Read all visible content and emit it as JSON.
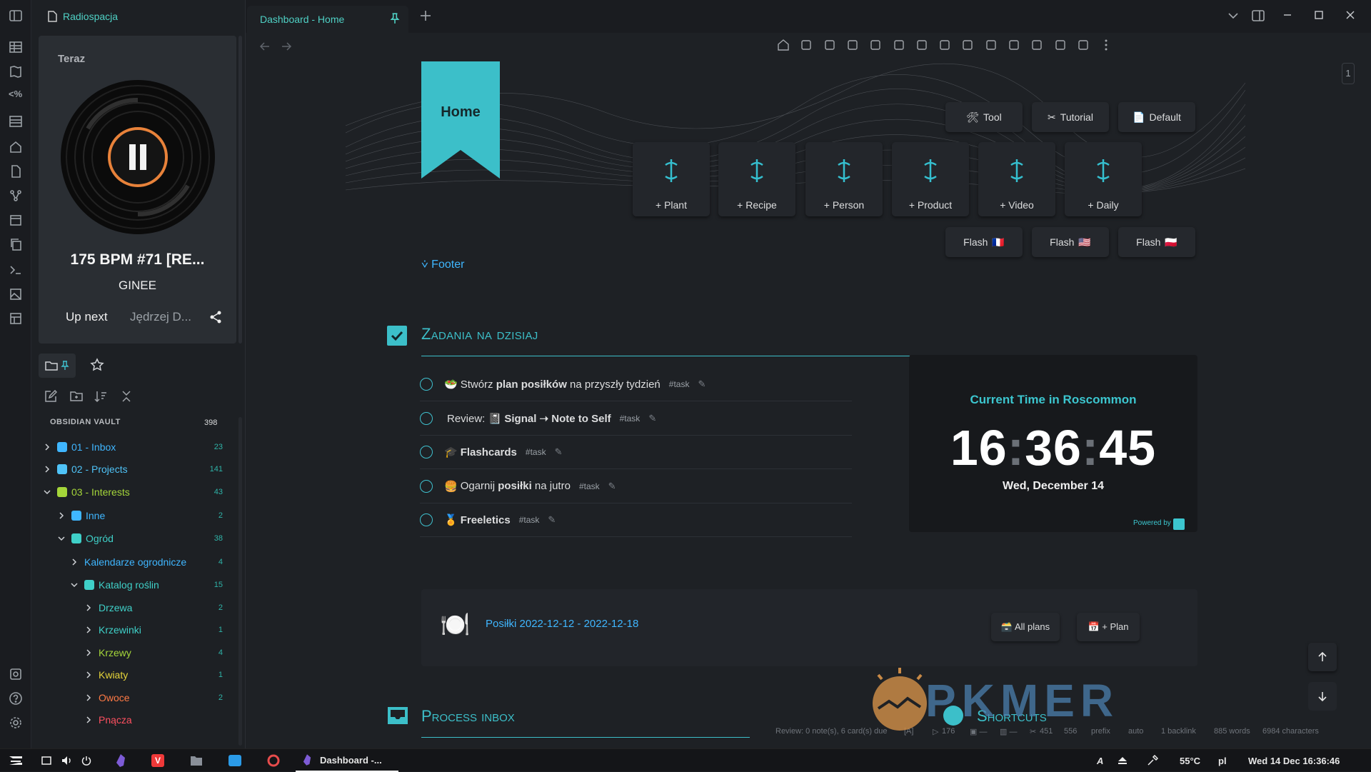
{
  "app": {
    "vault_name": "Radiospacja"
  },
  "tab": {
    "title": "Dashboard - Home"
  },
  "player": {
    "header": "Teraz",
    "track_title": "175 BPM #71 [RE...",
    "artist": "GINEE",
    "up_next_label": "Up next",
    "up_next_value": "Jędrzej D...",
    "accent": "#e8823a"
  },
  "vault": {
    "header": "OBSIDIAN VAULT",
    "count": "398",
    "items": [
      {
        "label": "01 - Inbox",
        "count": "23",
        "color": "#3fb6ff",
        "chevron": ">"
      },
      {
        "label": "02 - Projects",
        "count": "141",
        "color": "#4fc3f7",
        "chevron": ">"
      },
      {
        "label": "03 - Interests",
        "count": "43",
        "color": "#a5d63a",
        "chevron": "v"
      },
      {
        "label": "Inne",
        "count": "2",
        "color": "#3fb6ff",
        "chevron": ">"
      },
      {
        "label": "Ogród",
        "count": "38",
        "color": "#3fd0c8",
        "chevron": "v"
      },
      {
        "label": "Kalendarze ogrodnicze",
        "count": "4",
        "color": "#3fb6ff",
        "chevron": ">"
      },
      {
        "label": "Katalog roślin",
        "count": "15",
        "color": "#3fd0c8",
        "chevron": "v"
      },
      {
        "label": "Drzewa",
        "count": "2",
        "color": "#3fd0c8",
        "chevron": ">"
      },
      {
        "label": "Krzewinki",
        "count": "1",
        "color": "#3fd0c8",
        "chevron": ">"
      },
      {
        "label": "Krzewy",
        "count": "4",
        "color": "#a5d63a",
        "chevron": ">"
      },
      {
        "label": "Kwiaty",
        "count": "1",
        "color": "#e5d43a",
        "chevron": ">"
      },
      {
        "label": "Owoce",
        "count": "2",
        "color": "#ff7a45",
        "chevron": ">"
      },
      {
        "label": "Pnącza",
        "count": "",
        "color": "#ff5060",
        "chevron": ">"
      }
    ]
  },
  "home": {
    "banner": "Home",
    "footer_link": "⩒ Footer",
    "buttons": {
      "tool": "Tool",
      "tutorial": "Tutorial",
      "default": "Default"
    },
    "tiles": [
      "+ Plant",
      "+ Recipe",
      "+ Person",
      "+ Product",
      "+ Video",
      "+ Daily"
    ],
    "flash": [
      {
        "label": "Flash",
        "flag": "🇫🇷"
      },
      {
        "label": "Flash",
        "flag": "🇺🇸"
      },
      {
        "label": "Flash",
        "flag": "🇵🇱"
      }
    ]
  },
  "tasks": {
    "heading": "Zadania na dzisiaj",
    "items": [
      {
        "emoji": "🥗",
        "pre": "Stwórz ",
        "bold": "plan posiłków",
        "post": " na przyszły tydzień",
        "tag": "#task"
      },
      {
        "emoji": "",
        "pre": "Review: 📓 ",
        "bold": "Signal ➝ Note to Self",
        "post": "",
        "tag": "#task"
      },
      {
        "emoji": "🎓",
        "pre": "",
        "bold": "Flashcards",
        "post": "",
        "tag": "#task"
      },
      {
        "emoji": "🍔",
        "pre": "Ogarnij ",
        "bold": "posiłki",
        "post": " na jutro",
        "tag": "#task"
      },
      {
        "emoji": "🏅",
        "pre": "",
        "bold": "Freeletics",
        "post": "",
        "tag": "#task"
      }
    ]
  },
  "clock": {
    "title": "Current Time in Roscommon",
    "hh": "16",
    "mm": "36",
    "ss": "45",
    "date": "Wed, December 14",
    "powered": "Powered by"
  },
  "meals": {
    "icon": "🍽️",
    "link": "Posiłki 2022-12-12 - 2022-12-18",
    "all_plans": "🗃️ All plans",
    "add_plan": "📅 + Plan"
  },
  "sections": {
    "process_inbox": "Process inbox",
    "shortcuts": "Shortcuts"
  },
  "statusbar": {
    "review": "Review: 0 note(s), 6 card(s) due",
    "bracket": "[A]",
    "n1": "176",
    "n2": "451",
    "n3": "556",
    "prefix": "prefix",
    "auto": "auto",
    "backlinks": "1 backlink",
    "words": "885 words",
    "chars": "6984 characters"
  },
  "taskbar": {
    "window_title": "Dashboard -...",
    "lang_a": "A",
    "temp": "55°C",
    "kbd": "pl",
    "datetime": "Wed 14 Dec  16:36:46"
  },
  "watermark": "PKMER",
  "pane_number": "1"
}
